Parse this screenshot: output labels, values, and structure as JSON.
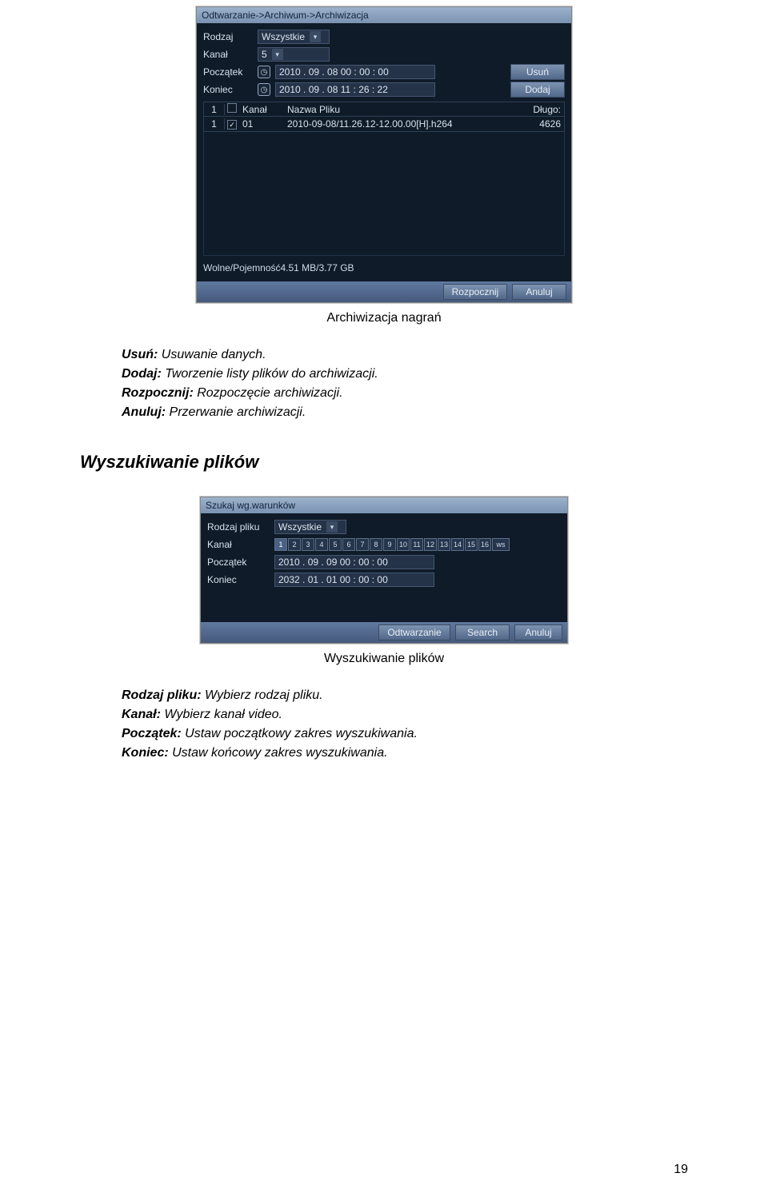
{
  "screenshot1": {
    "titlebar": "Odtwarzanie->Archiwum->Archiwizacja",
    "labels": {
      "rodzaj": "Rodzaj",
      "kanal": "Kanał",
      "poczatek": "Początek",
      "koniec": "Koniec"
    },
    "values": {
      "rodzaj": "Wszystkie",
      "kanal": "5",
      "poczatek": "2010 . 09 . 08  00 : 00 : 00",
      "koniec": "2010 . 09 . 08  11 : 26 : 22"
    },
    "buttons": {
      "usun": "Usuń",
      "dodaj": "Dodaj",
      "rozpocznij": "Rozpocznij",
      "anuluj": "Anuluj"
    },
    "table": {
      "header": {
        "n": "1",
        "kanal": "Kanał",
        "nazwa": "Nazwa Pliku",
        "dlugo": "Długo:"
      },
      "row": {
        "n": "1",
        "checked": true,
        "kanal": "01",
        "nazwa": "2010-09-08/11.26.12-12.00.00[H].h264",
        "dlugo": "4626"
      }
    },
    "status": "Wolne/Pojemność4.51 MB/3.77 GB"
  },
  "caption1": "Archiwizacja nagrań",
  "defs1": {
    "usun_k": "Usuń:",
    "usun_v": "Usuwanie danych.",
    "dodaj_k": "Dodaj:",
    "dodaj_v": "Tworzenie listy plików do archiwizacji.",
    "rozpocznij_k": "Rozpocznij:",
    "rozpocznij_v": "Rozpoczęcie archiwizacji.",
    "anuluj_k": "Anuluj:",
    "anuluj_v": "Przerwanie archiwizacji."
  },
  "section": "Wyszukiwanie plików",
  "screenshot2": {
    "titlebar": "Szukaj wg.warunków",
    "labels": {
      "rodzaj": "Rodzaj pliku",
      "kanal": "Kanał",
      "poczatek": "Początek",
      "koniec": "Koniec"
    },
    "values": {
      "rodzaj": "Wszystkie",
      "poczatek": "2010 . 09 . 09  00 : 00 : 00",
      "koniec": "2032 . 01 . 01  00 : 00 : 00"
    },
    "channels": [
      "1",
      "2",
      "3",
      "4",
      "5",
      "6",
      "7",
      "8",
      "9",
      "10",
      "11",
      "12",
      "13",
      "14",
      "15",
      "16",
      "ws"
    ],
    "buttons": {
      "odtwarzanie": "Odtwarzanie",
      "search": "Search",
      "anuluj": "Anuluj"
    }
  },
  "caption2": "Wyszukiwanie plików",
  "defs2": {
    "rodzaj_k": "Rodzaj pliku:",
    "rodzaj_v": "Wybierz rodzaj pliku.",
    "kanal_k": "Kanał:",
    "kanal_v": "Wybierz kanał video.",
    "poczatek_k": "Początek:",
    "poczatek_v": "Ustaw początkowy zakres wyszukiwania.",
    "koniec_k": "Koniec:",
    "koniec_v": "Ustaw końcowy zakres wyszukiwania."
  },
  "page": "19"
}
